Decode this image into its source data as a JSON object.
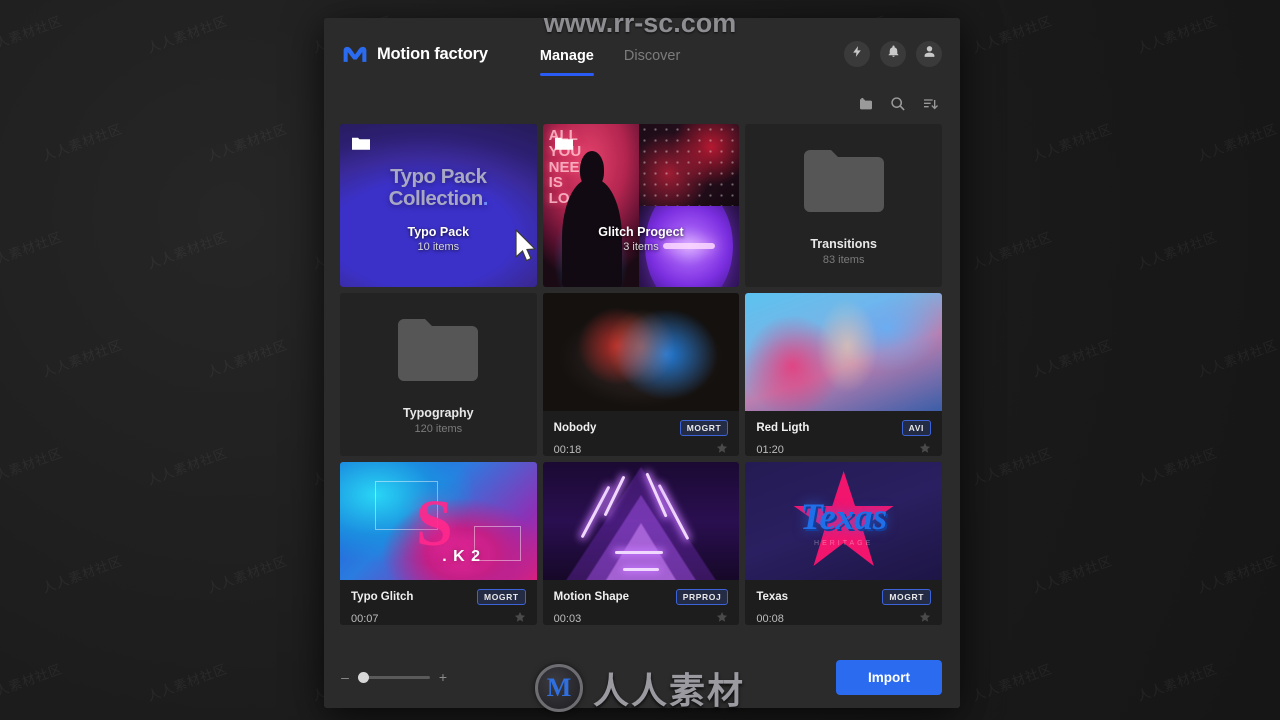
{
  "watermarks": {
    "top": "www.rr-sc.com",
    "bottom_cn": "人人素材",
    "bottom_logo_letter": "M",
    "tile": "人人素材社区"
  },
  "header": {
    "brand": "Motion factory",
    "tabs": [
      {
        "label": "Manage",
        "active": true
      },
      {
        "label": "Discover",
        "active": false
      }
    ],
    "actions": [
      {
        "name": "bolt-icon"
      },
      {
        "name": "bell-icon"
      },
      {
        "name": "user-icon"
      }
    ]
  },
  "toolbar": {
    "items": [
      {
        "name": "add-folder-icon"
      },
      {
        "name": "search-icon"
      },
      {
        "name": "sort-icon"
      }
    ]
  },
  "grid": {
    "items": [
      {
        "type": "collection",
        "style": "typo-pack",
        "title_line1": "Typo Pack",
        "title_line2": "Collection",
        "name": "Typo Pack",
        "count": "10 items"
      },
      {
        "type": "collection",
        "style": "collage",
        "overlay_text": "ALL\nYOU\nNEED\nIS\nLO",
        "name": "Glitch Progect",
        "count": "3 items"
      },
      {
        "type": "folder",
        "name": "Transitions",
        "count": "83 items"
      },
      {
        "type": "folder",
        "name": "Typography",
        "count": "120 items"
      },
      {
        "type": "asset",
        "style": "nobody",
        "name": "Nobody",
        "duration": "00:18",
        "badge": "MOGRT"
      },
      {
        "type": "asset",
        "style": "redligth",
        "name": "Red Ligth",
        "duration": "01:20",
        "badge": "AVI"
      },
      {
        "type": "asset",
        "style": "typoglitch",
        "name": "Typo Glitch",
        "duration": "00:07",
        "badge": "MOGRT",
        "art_s": "S",
        "art_k2": ". K 2"
      },
      {
        "type": "asset",
        "style": "motionshape",
        "name": "Motion Shape",
        "duration": "00:03",
        "badge": "PRPROJ"
      },
      {
        "type": "asset",
        "style": "texas",
        "name": "Texas",
        "duration": "00:08",
        "badge": "MOGRT",
        "art_word": "Texas",
        "art_sub": "HERITAGE"
      }
    ]
  },
  "footer": {
    "zoom_out": "–",
    "zoom_in": "+",
    "import_label": "Import"
  },
  "colors": {
    "accent_blue": "#2b6bf0",
    "tab_underline": "#2b5bf5",
    "badge_border": "#3d63d8",
    "panel_bg": "#2b2b2b",
    "card_bg": "#232323",
    "meta_bg": "#1d1d1d"
  }
}
